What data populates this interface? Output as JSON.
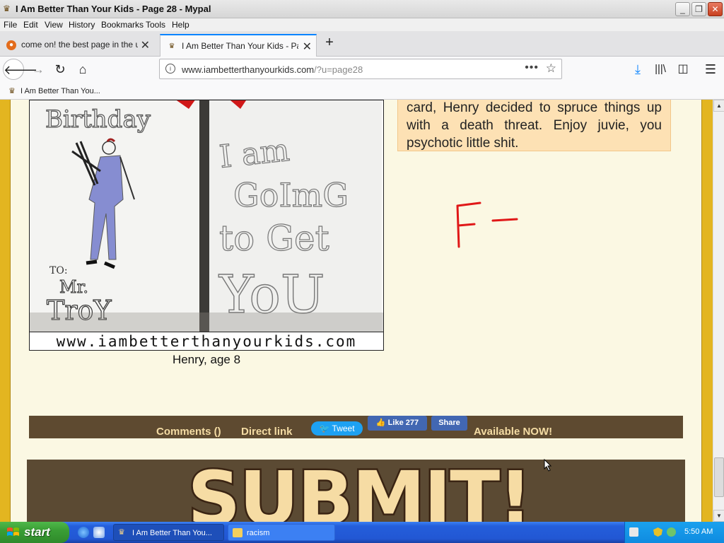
{
  "window": {
    "title": "I Am Better Than Your Kids - Page 28 - Mypal",
    "controls": {
      "minimize": "_",
      "restore": "❐",
      "close": "✕"
    }
  },
  "menu": {
    "items": [
      "File",
      "Edit",
      "View",
      "History",
      "Bookmarks",
      "Tools",
      "Help"
    ]
  },
  "tabs": [
    {
      "label": "come on! the best page in the uni",
      "active": false
    },
    {
      "label": "I Am Better Than Your Kids - Page",
      "active": true
    }
  ],
  "nav": {
    "url_host": "www.iambetterthanyourkids.com",
    "url_path": "/?u=page28",
    "page_actions": "•••"
  },
  "bookmarks": {
    "items": [
      "I Am Better Than You..."
    ]
  },
  "content": {
    "comic_watermark": "www.iambetterthanyourkids.com",
    "card_left_text": [
      "Birthday",
      "TO:",
      "Mr.",
      "TroY"
    ],
    "card_right_text": [
      "I am",
      "GoImG",
      "to Get",
      "YoU"
    ],
    "image_caption": "Henry, age 8",
    "review_text": "card, Henry decided to spruce things up with a death threat. Enjoy juvie, you psychotic little shit.",
    "grade": "F–",
    "share_bar": {
      "comments": "Comments ()",
      "direct_link": "Direct link",
      "tweet": "Tweet",
      "like": "Like 277",
      "share": "Share",
      "available": "Available NOW!"
    },
    "banner_text": "SUBMIT!"
  },
  "taskbar": {
    "start_label": "start",
    "tasks": [
      "I Am Better Than You...",
      "racism"
    ],
    "clock": "5:50 AM"
  },
  "colors": {
    "page_bg": "#fbf8e3",
    "side_border": "#e3b520",
    "text_box": "#fde1b4",
    "share_bar": "#5e4a30",
    "grade_red": "#e01818",
    "banner_text": "#f6dca4"
  }
}
